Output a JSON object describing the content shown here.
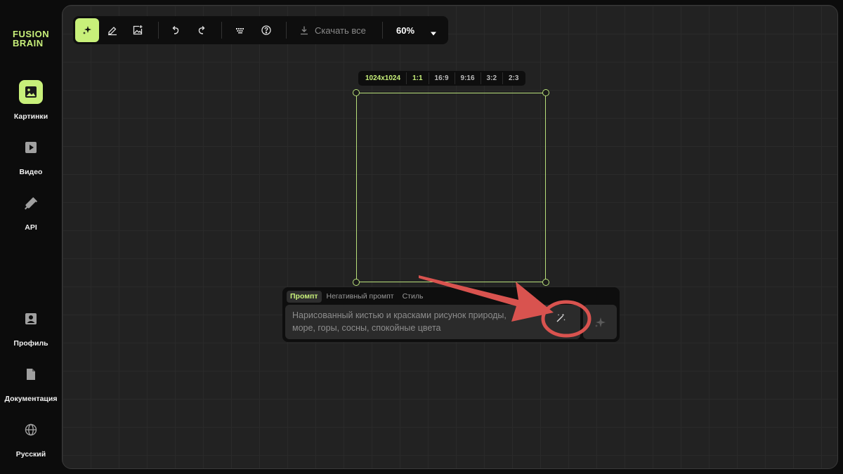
{
  "app": {
    "logo_line1": "FUSION",
    "logo_line2": "BRAIN",
    "accent": "#c8f07a"
  },
  "sidebar": {
    "items": [
      {
        "label": "Картинки",
        "icon": "image-icon",
        "active": true
      },
      {
        "label": "Видео",
        "icon": "video-play-icon",
        "active": false
      },
      {
        "label": "API",
        "icon": "plug-icon",
        "active": false
      }
    ],
    "bottom_items": [
      {
        "label": "Профиль",
        "icon": "profile-icon"
      },
      {
        "label": "Документация",
        "icon": "document-icon"
      },
      {
        "label": "Русский",
        "icon": "globe-icon"
      }
    ]
  },
  "toolbar": {
    "tools": [
      "magic-sparkle-icon",
      "eraser-icon",
      "image-add-icon",
      "undo-icon",
      "redo-icon",
      "keyboard-icon",
      "help-icon"
    ],
    "download_label": "Скачать все",
    "zoom": "60%"
  },
  "canvas": {
    "size_label": "1024x1024",
    "ratios": [
      "1:1",
      "16:9",
      "9:16",
      "3:2",
      "2:3"
    ],
    "active_ratio": "1:1"
  },
  "prompt": {
    "tabs": [
      "Промпт",
      "Негативный промпт",
      "Стиль"
    ],
    "active_tab": "Промпт",
    "placeholder_line1": "Нарисованный кистью и красками рисунок природы,",
    "placeholder_line2": "море, горы, сосны, спокойные цвета"
  },
  "annotation": {
    "color": "#d9534f"
  }
}
